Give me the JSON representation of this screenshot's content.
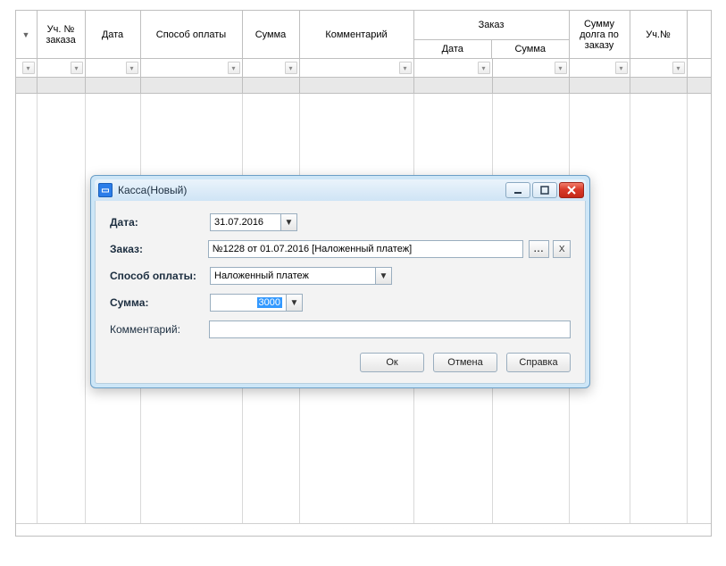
{
  "grid": {
    "columns": {
      "uch_no": "Уч. №\nзаказа",
      "date": "Дата",
      "payment_method": "Способ оплаты",
      "sum": "Сумма",
      "comment": "Комментарий",
      "order_group": "Заказ",
      "order_date": "Дата",
      "order_sum": "Сумма",
      "debt": "Сумму долга по заказу",
      "wh": "Уч.№"
    }
  },
  "dialog": {
    "title": "Касса(Новый)",
    "labels": {
      "date": "Дата:",
      "order": "Заказ:",
      "payment": "Способ оплаты:",
      "sum": "Сумма:",
      "comment": "Комментарий:"
    },
    "values": {
      "date": "31.07.2016",
      "order": "№1228 от 01.07.2016 [Наложенный платеж]",
      "payment": "Наложенный платеж",
      "sum": "3000",
      "comment": ""
    },
    "buttons": {
      "ok": "Ок",
      "cancel": "Отмена",
      "help": "Справка",
      "ellipsis": "...",
      "clear": "X"
    }
  }
}
